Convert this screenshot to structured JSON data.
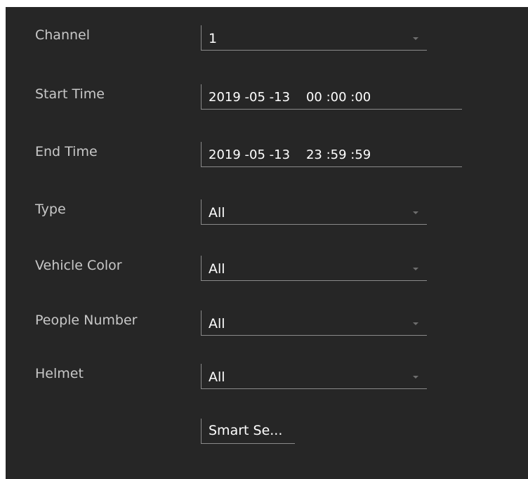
{
  "form": {
    "channel": {
      "label": "Channel",
      "value": "1"
    },
    "start_time": {
      "label": "Start Time",
      "value": "2019 -05 -13    00 :00 :00"
    },
    "end_time": {
      "label": "End Time",
      "value": "2019 -05 -13    23 :59 :59"
    },
    "type": {
      "label": "Type",
      "value": "All"
    },
    "vehicle_color": {
      "label": "Vehicle Color",
      "value": "All"
    },
    "people_number": {
      "label": "People Number",
      "value": "All"
    },
    "helmet": {
      "label": "Helmet",
      "value": "All"
    }
  },
  "actions": {
    "smart_search_label": "Smart Se..."
  },
  "colors": {
    "panel_bg": "#262626",
    "label_text": "#c8c8c8",
    "value_text": "#ffffff",
    "field_border": "#8a8a8a"
  }
}
